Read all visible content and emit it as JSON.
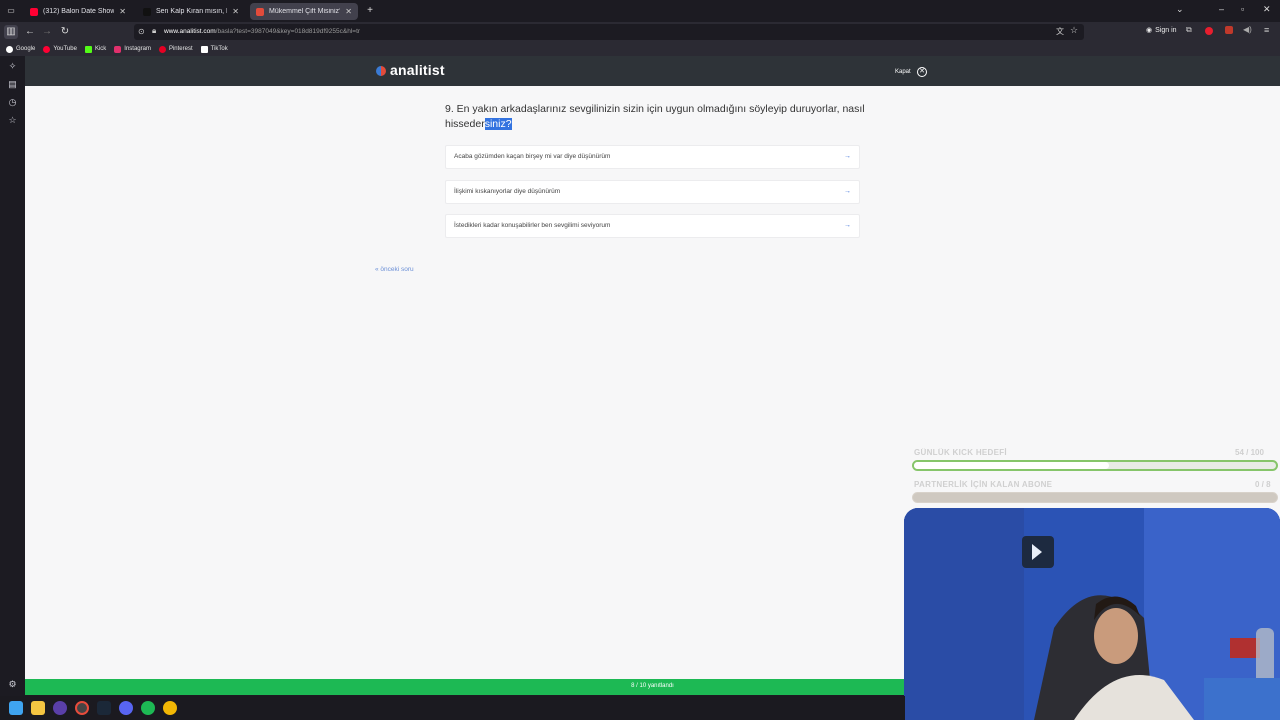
{
  "browser": {
    "tabs": [
      {
        "label": "(312) Balon Date Show 30. Bölü",
        "favicon_color": "#ff0033"
      },
      {
        "label": "Sen Kalp Kıran mısın, Kalbi Kırı",
        "favicon_color": "#111111"
      },
      {
        "label": "Mükemmel Çift Misiniz? - Anali",
        "favicon_color": "#e24b3b",
        "active": true
      }
    ],
    "new_tab_label": "+",
    "url_host": "www.analitist.com",
    "url_path": "/basla?test=3987049&key=018d819df9255c&hl=tr",
    "sign_in_label": "Sign in",
    "bookmarks": [
      {
        "label": "Google",
        "icon": "google-icon",
        "color": "#ffffff"
      },
      {
        "label": "YouTube",
        "icon": "youtube-icon",
        "color": "#ff0033"
      },
      {
        "label": "Kick",
        "icon": "kick-icon",
        "color": "#53fc18"
      },
      {
        "label": "Instagram",
        "icon": "instagram-icon",
        "color": "#e1306c"
      },
      {
        "label": "Pinterest",
        "icon": "pinterest-icon",
        "color": "#e60023"
      },
      {
        "label": "TikTok",
        "icon": "tiktok-icon",
        "color": "#ffffff"
      }
    ]
  },
  "site": {
    "brand": "analitist",
    "quit_label": "Kapat",
    "question_main": "9. En yakın arkadaşlarınız sevgilinizin sizin için uygun olmadığını söyleyip duruyorlar, nasıl hissedersiniz?",
    "question_prefix": "9. En yakın arkadaşlarınız sevgilinizin sizin için uygun olmadığını söyleyip duruyorlar, nasıl hisseder",
    "question_highlight": "siniz?",
    "answers": [
      {
        "label": "Acaba gözümden kaçan birşey mi var diye düşünürüm"
      },
      {
        "label": "İlişkimi kıskanıyorlar diye düşünürüm"
      },
      {
        "label": "İstedikleri kadar konuşabilirler ben sevgilimi seviyorum"
      }
    ],
    "prev_label": "« önceki soru",
    "progress_label": "8 / 10 yanıtlandı",
    "progress_value": 0.8
  },
  "overlay": {
    "goal1_label": "GÜNLÜK KICK HEDEFİ",
    "goal1_count": "54 / 100",
    "goal1_fraction": 0.54,
    "goal2_label": "PARTNERLİK İÇİN KALAN ABONE",
    "goal2_count": "0 / 8",
    "goal2_fraction": 0.0
  }
}
